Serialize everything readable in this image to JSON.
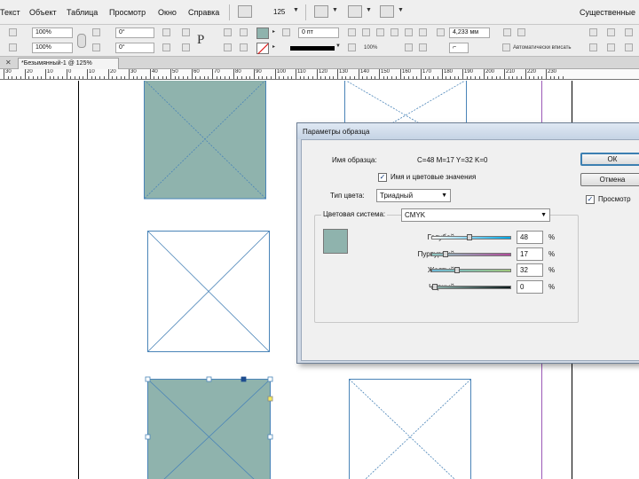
{
  "menu": {
    "items": [
      "Текст",
      "Объект",
      "Таблица",
      "Просмотр",
      "Окно",
      "Справка"
    ],
    "zoom": "125",
    "workspace": "Существенные"
  },
  "control": {
    "scale_x": "100%",
    "scale_y": "100%",
    "rotate": "0°",
    "shear": "0°",
    "stroke_weight": "0 пт",
    "fit_percent": "100%",
    "offset": "4,233 мм",
    "auto_fit": "Автоматически вписать"
  },
  "document": {
    "tab_label": "*Безымянный-1 @ 125%"
  },
  "ruler": {
    "labels": [
      "30",
      "20",
      "10",
      "0",
      "10",
      "20",
      "30",
      "40",
      "50",
      "60",
      "70",
      "80",
      "90",
      "100",
      "110",
      "120",
      "130",
      "140",
      "150",
      "160",
      "170",
      "180",
      "190",
      "200",
      "210",
      "220",
      "230"
    ]
  },
  "colors": {
    "swatch": "#8fb3ad",
    "frame_stroke": "#4a84b8",
    "margin_line": "#9b59b6"
  },
  "dialog": {
    "title": "Параметры образца",
    "swatch_name_label": "Имя образца:",
    "swatch_name_value": "C=48 M=17 Y=32 K=0",
    "name_with_value_label": "Имя и цветовые значения",
    "name_with_value_checked": true,
    "color_type_label": "Тип цвета:",
    "color_type_value": "Триадный",
    "color_mode_label": "Цветовая система:",
    "color_mode_value": "CMYK",
    "channels": [
      {
        "label": "Голубой",
        "value": "48",
        "unit": "%",
        "level": 0.48
      },
      {
        "label": "Пурпурный",
        "value": "17",
        "unit": "%",
        "level": 0.17
      },
      {
        "label": "Желтый",
        "value": "32",
        "unit": "%",
        "level": 0.32
      },
      {
        "label": "Черный",
        "value": "0",
        "unit": "%",
        "level": 0.0
      }
    ],
    "ok_label": "ОК",
    "cancel_label": "Отмена",
    "preview_label": "Просмотр",
    "preview_checked": true
  }
}
